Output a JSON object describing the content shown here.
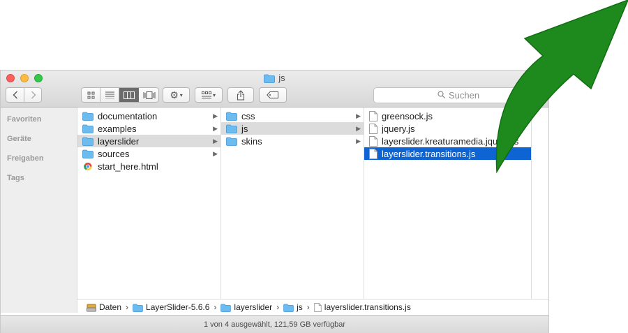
{
  "window": {
    "title": "js"
  },
  "toolbar": {
    "back_icon": "chevron-left-icon",
    "forward_icon": "chevron-right-icon",
    "view_modes": [
      "icon-view-icon",
      "list-view-icon",
      "column-view-icon",
      "cover-flow-icon"
    ],
    "active_view": "column-view-icon",
    "action_icon": "gear-icon",
    "arrange_icon": "arrange-grid-icon",
    "share_icon": "share-icon",
    "tag_icon": "tag-icon"
  },
  "search": {
    "placeholder": "Suchen",
    "icon": "search-icon"
  },
  "sidebar": {
    "sections": [
      "Favoriten",
      "Geräte",
      "Freigaben",
      "Tags"
    ]
  },
  "columns": [
    {
      "items": [
        {
          "name": "documentation",
          "type": "folder",
          "has_children": true
        },
        {
          "name": "examples",
          "type": "folder",
          "has_children": true
        },
        {
          "name": "layerslider",
          "type": "folder",
          "has_children": true,
          "state": "highlighted"
        },
        {
          "name": "sources",
          "type": "folder",
          "has_children": true
        },
        {
          "name": "start_here.html",
          "type": "html",
          "has_children": false
        }
      ]
    },
    {
      "items": [
        {
          "name": "css",
          "type": "folder",
          "has_children": true
        },
        {
          "name": "js",
          "type": "folder",
          "has_children": true,
          "state": "highlighted"
        },
        {
          "name": "skins",
          "type": "folder",
          "has_children": true
        }
      ]
    },
    {
      "items": [
        {
          "name": "greensock.js",
          "type": "file"
        },
        {
          "name": "jquery.js",
          "type": "file"
        },
        {
          "name": "layerslider.kreaturamedia.jquery.js",
          "type": "file"
        },
        {
          "name": "layerslider.transitions.js",
          "type": "file",
          "state": "selected"
        }
      ]
    }
  ],
  "pathbar": {
    "segments": [
      {
        "label": "Daten",
        "icon": "drive-icon"
      },
      {
        "label": "LayerSlider-5.6.6",
        "icon": "folder-icon"
      },
      {
        "label": "layerslider",
        "icon": "folder-icon"
      },
      {
        "label": "js",
        "icon": "folder-icon"
      },
      {
        "label": "layerslider.transitions.js",
        "icon": "file-icon"
      }
    ]
  },
  "status": {
    "text": "1 von 4 ausgewählt, 121,59 GB verfügbar"
  },
  "colors": {
    "selection": "#0e64d3",
    "highlight": "#dcdcdc",
    "folder": "#59b4ee",
    "arrow": "#1e8a1e"
  }
}
